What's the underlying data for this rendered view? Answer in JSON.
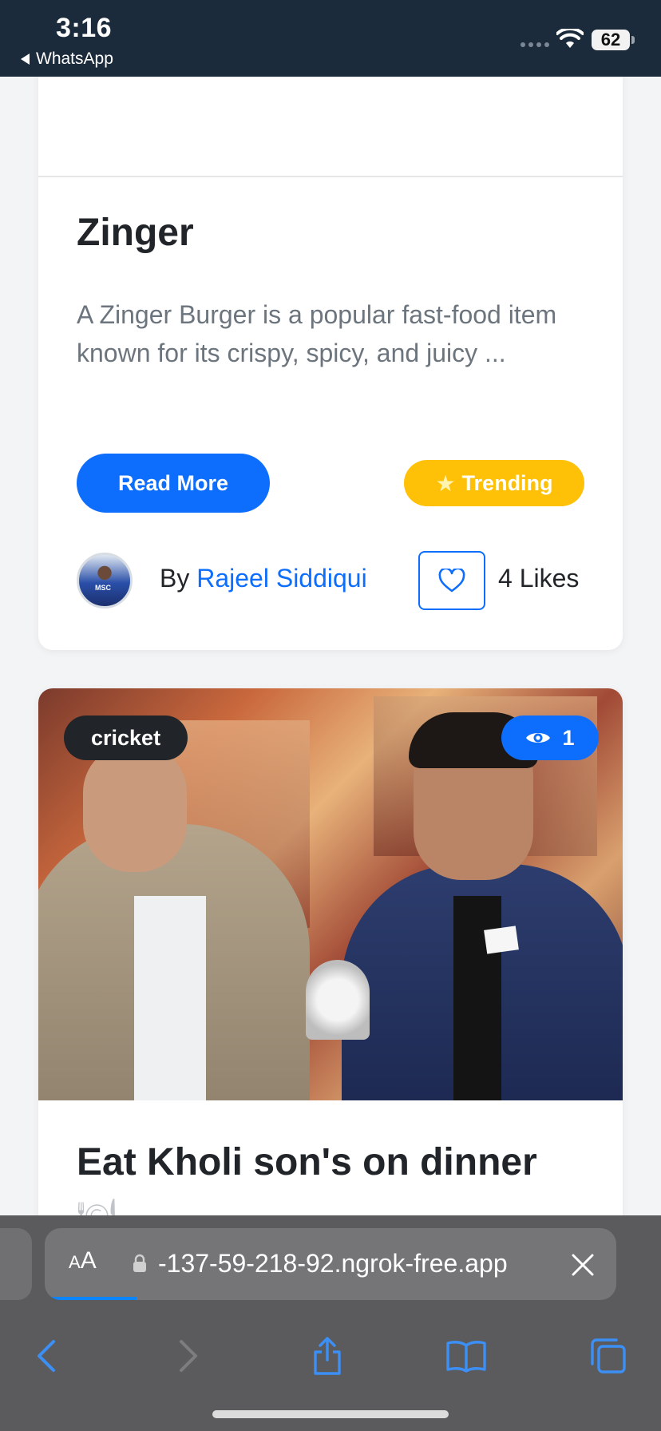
{
  "status_bar": {
    "time": "3:16",
    "back_app": "WhatsApp",
    "battery": "62"
  },
  "posts": [
    {
      "title": "Zinger",
      "excerpt": "A Zinger Burger is a popular fast-food item known for its crispy, spicy, and juicy ...",
      "read_more_label": "Read More",
      "trending_label": "Trending",
      "author_prefix": "By",
      "author_name": "Rajeel Siddiqui",
      "avatar_text": "MSC",
      "likes": "4 Likes"
    },
    {
      "category": "cricket",
      "views": "1",
      "title": "Eat Kholi son's on dinner"
    }
  ],
  "browser": {
    "text_size_label": "AA",
    "url": "-137-59-218-92.ngrok-free.app",
    "load_progress": 0.16
  },
  "colors": {
    "primary": "#0d6efd",
    "trending": "#ffc107",
    "dark_badge": "#212529",
    "status_bar_bg": "#1c2b3b",
    "safari_bg": "#5b5b5d"
  },
  "icons": {
    "like": "heart-outline-icon",
    "views": "eye-icon",
    "trending": "star-icon",
    "lock": "lock-icon",
    "close": "close-icon",
    "back": "chevron-left-icon",
    "forward": "chevron-right-icon",
    "share": "share-icon",
    "bookmarks": "book-icon",
    "tabs": "tabs-icon"
  }
}
